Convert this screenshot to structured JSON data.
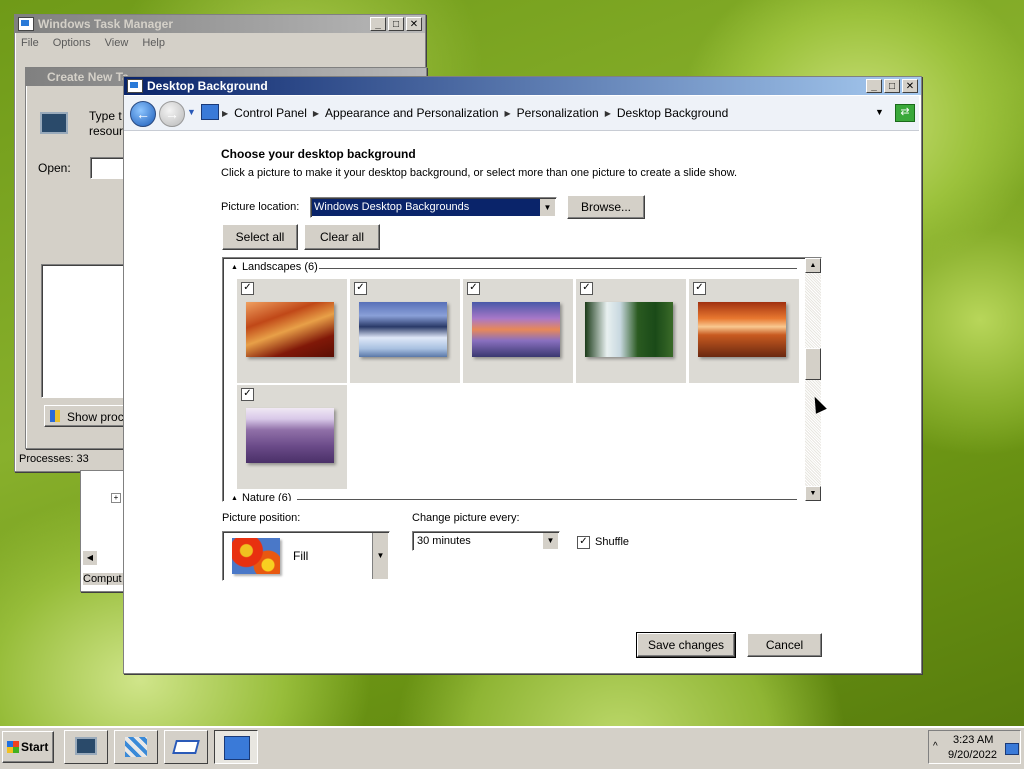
{
  "taskmgr": {
    "title": "Windows Task Manager",
    "menu": [
      "File",
      "Options",
      "View",
      "Help"
    ],
    "status": "Processes: 33"
  },
  "create_task": {
    "title": "Create New Ta",
    "desc": "Type t",
    "desc2": "resour",
    "open_label": "Open:",
    "show_btn": "Show proce",
    "comput": "Comput"
  },
  "desktop_bg": {
    "title": "Desktop Background",
    "breadcrumbs": [
      "Control Panel",
      "Appearance and Personalization",
      "Personalization",
      "Desktop Background"
    ],
    "heading": "Choose your desktop background",
    "instructions": "Click a picture to make it your desktop background, or select more than one picture to create a slide show.",
    "location_label": "Picture location:",
    "location_value": "Windows Desktop Backgrounds",
    "browse": "Browse...",
    "select_all": "Select all",
    "clear_all": "Clear all",
    "group1": "Landscapes (6)",
    "group2": "Nature (6)",
    "position_label": "Picture position:",
    "position_value": "Fill",
    "interval_label": "Change picture every:",
    "interval_value": "30 minutes",
    "shuffle": "Shuffle",
    "save": "Save changes",
    "cancel": "Cancel"
  },
  "taskbar": {
    "start": "Start",
    "time": "3:23 AM",
    "date": "9/20/2022"
  }
}
